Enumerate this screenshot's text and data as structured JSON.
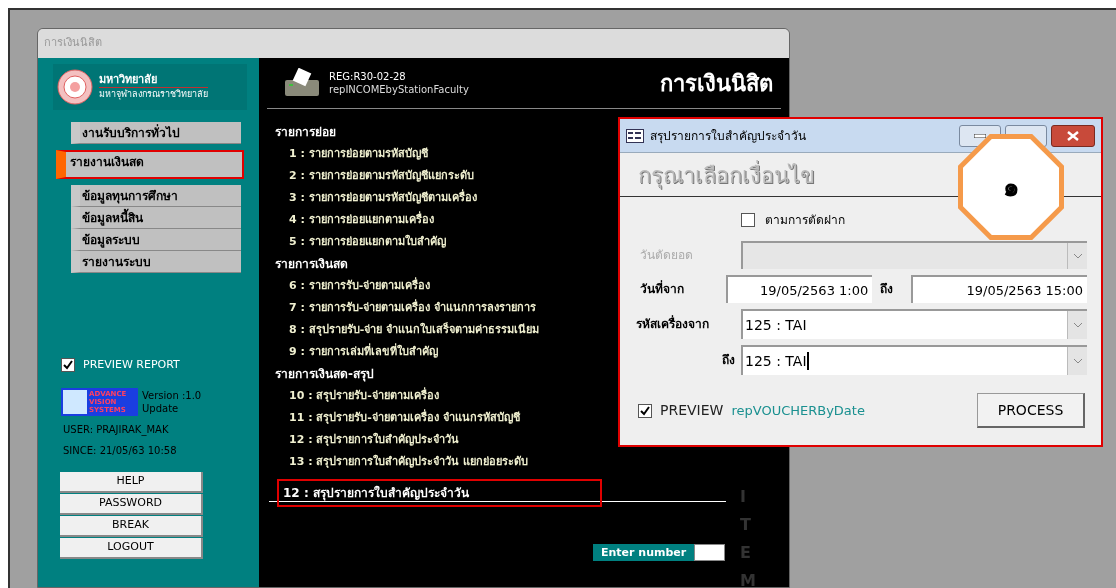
{
  "window": {
    "title": "การเงินนิสิต"
  },
  "sidebar": {
    "logo_title": "มหาวิทยาลัย",
    "logo_subtitle": "มหาจุฬาลงกรณราชวิทยาลัย",
    "items": [
      {
        "label": "งานรับบริการทั่วไป",
        "selected": false
      },
      {
        "label": "รายงานเงินสด",
        "selected": true
      },
      {
        "label": "ข้อมูลทุนการศึกษา",
        "selected": false
      },
      {
        "label": "ข้อมูลหนี้สิน",
        "selected": false
      },
      {
        "label": "ข้อมูลระบบ",
        "selected": false
      },
      {
        "label": "รายงานระบบ",
        "selected": false
      }
    ],
    "preview_report": {
      "label": "PREVIEW REPORT",
      "checked": true
    },
    "vendor_logo": [
      "ADVANCE",
      "VISION",
      "SYSTEMS"
    ],
    "version": "Version :1.0",
    "update": "Update",
    "user": "USER: PRAJIRAK_MAK",
    "since": "SINCE: 21/05/63 10:58",
    "buttons": [
      "HELP",
      "PASSWORD",
      "BREAK",
      "LOGOUT"
    ]
  },
  "report_header": {
    "code": "REG:R30-02-28",
    "name": "repINCOMEbyStationFaculty",
    "title": "การเงินนิสิต"
  },
  "menu": [
    {
      "heading": "รายการย่อย",
      "items": [
        "1 : รายการย่อยตามรหัสบัญชี",
        "2 : รายการย่อยตามรหัสบัญชีแยกระดับ",
        "3 : รายการย่อยตามรหัสบัญชีตามเครื่อง",
        "4 : รายการย่อยแยกตามเครื่อง",
        "5 : รายการย่อยแยกตามใบสำคัญ"
      ]
    },
    {
      "heading": "รายการเงินสด",
      "items": [
        "6 : รายการรับ-จ่ายตามเครื่อง",
        "7 : รายการรับ-จ่ายตามเครื่อง จำแนกการลงรายการ",
        "8 : สรุปรายรับ-จ่าย จำแนกใบเสร็จตามค่าธรรมเนียม",
        "9 : รายการเล่มที่เลขที่ใบสำคัญ"
      ]
    },
    {
      "heading": "รายการเงินสด-สรุป",
      "items": [
        "10 : สรุปรายรับ-จ่ายตามเครื่อง",
        "11 : สรุปรายรับ-จ่ายตามเครื่อง จำแนกรหัสบัญชี",
        "12 : สรุปรายการใบสำคัญประจำวัน",
        "13 : สรุปรายการใบสำคัญประจำวัน แยกย่อยระดับ"
      ]
    }
  ],
  "selection_entry": "12 : สรุปรายการใบสำคัญประจำวัน",
  "enter_number": {
    "label": "Enter number"
  },
  "side_caption": "ITEM",
  "dialog": {
    "title": "สรุปรายการใบสำคัญประจำวัน",
    "heading": "กรุณาเลือกเงื่อนไข",
    "by_deposit": {
      "label": "ตามการตัดฝาก",
      "checked": false
    },
    "cutoff": {
      "label": "วันตัดยอด",
      "disabled": true
    },
    "date_from": {
      "label": "วันที่จาก",
      "value": "19/05/2563 1:00"
    },
    "date_to": {
      "label": "ถึง",
      "value": "19/05/2563 15:00"
    },
    "station_from": {
      "label": "รหัสเครื่องจาก",
      "value": "125 : TAI"
    },
    "station_to": {
      "label": "ถึง",
      "value": "125 : TAI"
    },
    "preview": {
      "label": "PREVIEW",
      "checked": true
    },
    "report_name": "repVOUCHERByDate",
    "process_button": "PROCESS"
  },
  "annotation": {
    "label": "๑"
  }
}
